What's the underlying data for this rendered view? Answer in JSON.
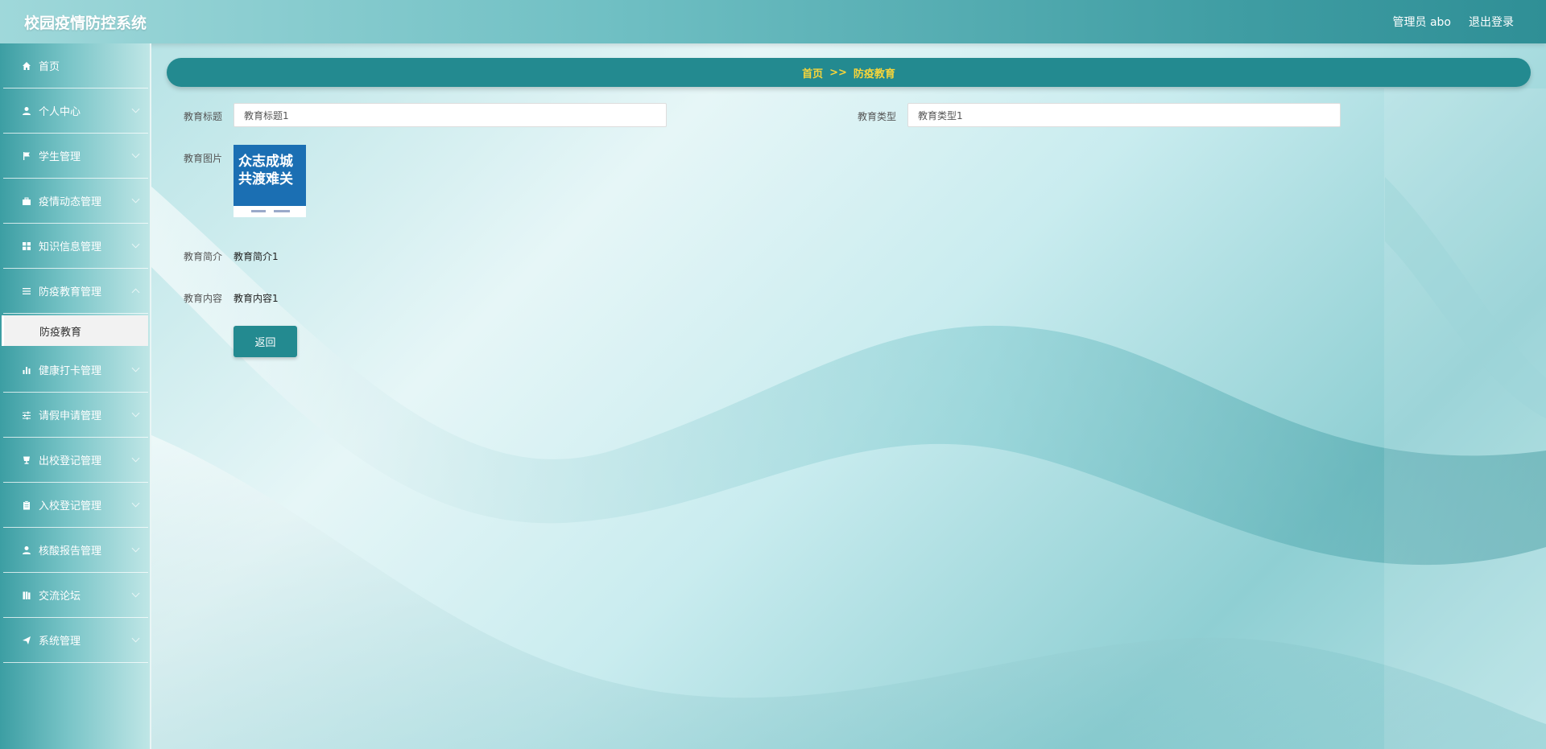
{
  "app": {
    "title": "校园疫情防控系统"
  },
  "header": {
    "user_label": "管理员 abo",
    "logout_label": "退出登录"
  },
  "sidebar": {
    "items": [
      {
        "label": "首页",
        "icon": "home-icon",
        "has_submenu": false
      },
      {
        "label": "个人中心",
        "icon": "user-icon",
        "has_submenu": true
      },
      {
        "label": "学生管理",
        "icon": "flag-icon",
        "has_submenu": true
      },
      {
        "label": "疫情动态管理",
        "icon": "briefcase-icon",
        "has_submenu": true
      },
      {
        "label": "知识信息管理",
        "icon": "grid-icon",
        "has_submenu": true
      },
      {
        "label": "防疫教育管理",
        "icon": "list-icon",
        "has_submenu": true,
        "expanded": true
      },
      {
        "label": "健康打卡管理",
        "icon": "bar-chart-icon",
        "has_submenu": true
      },
      {
        "label": "请假申请管理",
        "icon": "sliders-icon",
        "has_submenu": true
      },
      {
        "label": "出校登记管理",
        "icon": "cup-icon",
        "has_submenu": true
      },
      {
        "label": "入校登记管理",
        "icon": "clipboard-icon",
        "has_submenu": true
      },
      {
        "label": "核酸报告管理",
        "icon": "user-icon",
        "has_submenu": true
      },
      {
        "label": "交流论坛",
        "icon": "book-icon",
        "has_submenu": true
      },
      {
        "label": "系统管理",
        "icon": "send-icon",
        "has_submenu": true
      }
    ],
    "active_subitem": "防疫教育"
  },
  "breadcrumb": {
    "home": "首页",
    "separator": ">>",
    "current": "防疫教育"
  },
  "form": {
    "title_label": "教育标题",
    "title_value": "教育标题1",
    "type_label": "教育类型",
    "type_value": "教育类型1",
    "image_label": "教育图片",
    "image_text_line1": "众志成城",
    "image_text_line2": "共渡难关",
    "summary_label": "教育简介",
    "summary_value": "教育简介1",
    "content_label": "教育内容",
    "content_value": "教育内容1",
    "back_button": "返回"
  },
  "colors": {
    "header_gradient_start": "#9fd8da",
    "header_gradient_end": "#2f8f96",
    "breadcrumb_bg": "#238a90",
    "breadcrumb_text": "#f6d53a",
    "button_bg": "#238a90",
    "active_subitem_bg": "#f2f2f2"
  }
}
